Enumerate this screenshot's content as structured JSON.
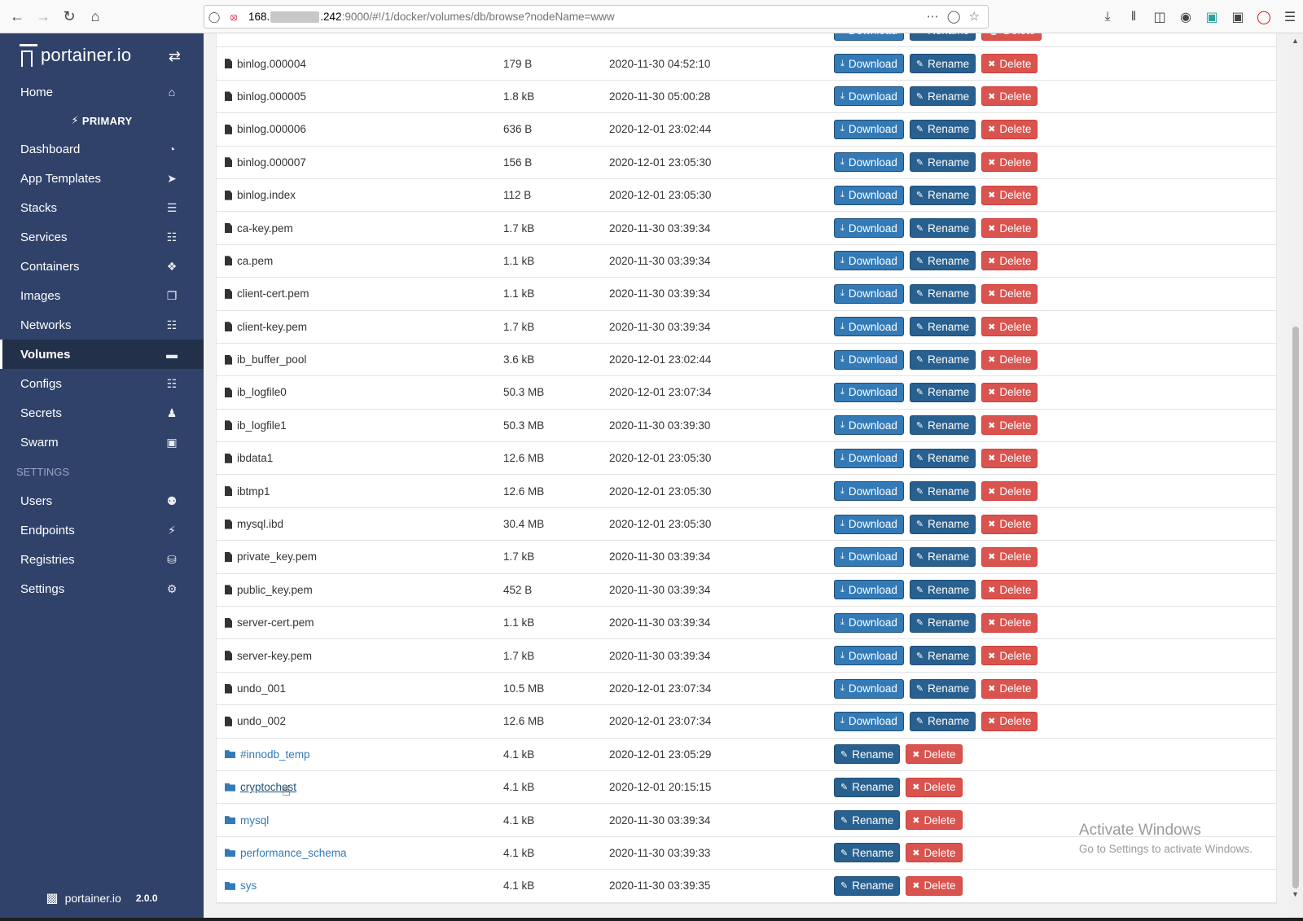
{
  "browser": {
    "url_host": "168.",
    "url_host_tail": ".242",
    "url_path": ":9000/#!/1/docker/volumes/db/browse?nodeName=www"
  },
  "sidebar": {
    "brand": "portainer.io",
    "home": "Home",
    "endpoint_label": "PRIMARY",
    "items": [
      {
        "label": "Dashboard",
        "icon": "tachometer-icon"
      },
      {
        "label": "App Templates",
        "icon": "rocket-icon"
      },
      {
        "label": "Stacks",
        "icon": "th-list-icon"
      },
      {
        "label": "Services",
        "icon": "list-alt-icon"
      },
      {
        "label": "Containers",
        "icon": "cubes-icon"
      },
      {
        "label": "Images",
        "icon": "clone-icon"
      },
      {
        "label": "Networks",
        "icon": "sitemap-icon"
      },
      {
        "label": "Volumes",
        "icon": "hdd-icon"
      },
      {
        "label": "Configs",
        "icon": "file-code-icon"
      },
      {
        "label": "Secrets",
        "icon": "user-secret-icon"
      },
      {
        "label": "Swarm",
        "icon": "object-group-icon"
      }
    ],
    "settings_heading": "SETTINGS",
    "settings_items": [
      {
        "label": "Users",
        "icon": "users-icon"
      },
      {
        "label": "Endpoints",
        "icon": "plug-icon"
      },
      {
        "label": "Registries",
        "icon": "database-icon"
      },
      {
        "label": "Settings",
        "icon": "cogs-icon"
      }
    ],
    "footer_brand": "portainer.io",
    "version": "2.0.0"
  },
  "buttons": {
    "download": "Download",
    "rename": "Rename",
    "delete": "Delete"
  },
  "files": [
    {
      "name": "binlog.000004",
      "size": "179 B",
      "modified": "2020-11-30 04:52:10"
    },
    {
      "name": "binlog.000005",
      "size": "1.8 kB",
      "modified": "2020-11-30 05:00:28"
    },
    {
      "name": "binlog.000006",
      "size": "636 B",
      "modified": "2020-12-01 23:02:44"
    },
    {
      "name": "binlog.000007",
      "size": "156 B",
      "modified": "2020-12-01 23:05:30"
    },
    {
      "name": "binlog.index",
      "size": "112 B",
      "modified": "2020-12-01 23:05:30"
    },
    {
      "name": "ca-key.pem",
      "size": "1.7 kB",
      "modified": "2020-11-30 03:39:34"
    },
    {
      "name": "ca.pem",
      "size": "1.1 kB",
      "modified": "2020-11-30 03:39:34"
    },
    {
      "name": "client-cert.pem",
      "size": "1.1 kB",
      "modified": "2020-11-30 03:39:34"
    },
    {
      "name": "client-key.pem",
      "size": "1.7 kB",
      "modified": "2020-11-30 03:39:34"
    },
    {
      "name": "ib_buffer_pool",
      "size": "3.6 kB",
      "modified": "2020-12-01 23:02:44"
    },
    {
      "name": "ib_logfile0",
      "size": "50.3 MB",
      "modified": "2020-12-01 23:07:34"
    },
    {
      "name": "ib_logfile1",
      "size": "50.3 MB",
      "modified": "2020-11-30 03:39:30"
    },
    {
      "name": "ibdata1",
      "size": "12.6 MB",
      "modified": "2020-12-01 23:05:30"
    },
    {
      "name": "ibtmp1",
      "size": "12.6 MB",
      "modified": "2020-12-01 23:05:30"
    },
    {
      "name": "mysql.ibd",
      "size": "30.4 MB",
      "modified": "2020-12-01 23:05:30"
    },
    {
      "name": "private_key.pem",
      "size": "1.7 kB",
      "modified": "2020-11-30 03:39:34"
    },
    {
      "name": "public_key.pem",
      "size": "452 B",
      "modified": "2020-11-30 03:39:34"
    },
    {
      "name": "server-cert.pem",
      "size": "1.1 kB",
      "modified": "2020-11-30 03:39:34"
    },
    {
      "name": "server-key.pem",
      "size": "1.7 kB",
      "modified": "2020-11-30 03:39:34"
    },
    {
      "name": "undo_001",
      "size": "10.5 MB",
      "modified": "2020-12-01 23:07:34"
    },
    {
      "name": "undo_002",
      "size": "12.6 MB",
      "modified": "2020-12-01 23:07:34"
    }
  ],
  "folders": [
    {
      "name": "#innodb_temp",
      "size": "4.1 kB",
      "modified": "2020-12-01 23:05:29"
    },
    {
      "name": "cryptochest",
      "size": "4.1 kB",
      "modified": "2020-12-01 20:15:15",
      "hovered": true
    },
    {
      "name": "mysql",
      "size": "4.1 kB",
      "modified": "2020-11-30 03:39:34"
    },
    {
      "name": "performance_schema",
      "size": "4.1 kB",
      "modified": "2020-11-30 03:39:33"
    },
    {
      "name": "sys",
      "size": "4.1 kB",
      "modified": "2020-11-30 03:39:35"
    }
  ],
  "watermark": {
    "line1": "Activate Windows",
    "line2": "Go to Settings to activate Windows."
  },
  "colors": {
    "sidebar_bg": "#30426a",
    "primary": "#337ab7",
    "danger": "#d9534f"
  }
}
